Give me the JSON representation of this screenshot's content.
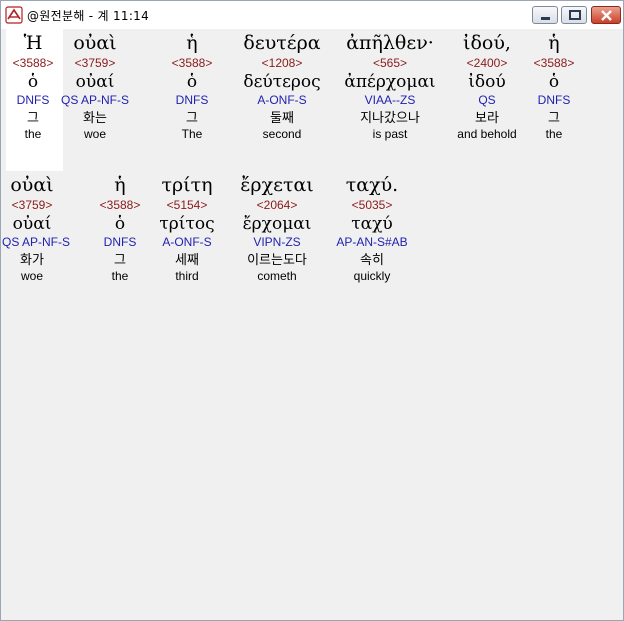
{
  "window": {
    "title": "@원전분해 - 계 11:14"
  },
  "rows": [
    [
      {
        "greek": "Ἡ",
        "strong": "<3588>",
        "lemma": "ὁ",
        "morph": "DNFS",
        "korean": "그",
        "english": "the"
      },
      {
        "greek": "οὐαὶ",
        "strong": "<3759>",
        "lemma": "οὐαί",
        "morph": "QS AP-NF-S",
        "korean": "화는",
        "english": "woe"
      },
      {
        "greek": "ἡ",
        "strong": "<3588>",
        "lemma": "ὁ",
        "morph": "DNFS",
        "korean": "그",
        "english": "The"
      },
      {
        "greek": "δευτέρα",
        "strong": "<1208>",
        "lemma": "δεύτερος",
        "morph": "A-ONF-S",
        "korean": "둘째",
        "english": "second"
      },
      {
        "greek": "ἀπῆλθεν·",
        "strong": "<565>",
        "lemma": "ἀπέρχομαι",
        "morph": "VIAA--ZS",
        "korean": "지나갔으나",
        "english": "is past"
      },
      {
        "greek": "ἰδού,",
        "strong": "<2400>",
        "lemma": "ἰδού",
        "morph": "QS",
        "korean": "보라",
        "english": "and behold"
      },
      {
        "greek": "ἡ",
        "strong": "<3588>",
        "lemma": "ὁ",
        "morph": "DNFS",
        "korean": "그",
        "english": "the"
      }
    ],
    [
      {
        "greek": "οὐαὶ",
        "strong": "<3759>",
        "lemma": "οὐαί",
        "morph": "QS AP-NF-S",
        "korean": "화가",
        "english": "woe"
      },
      {
        "greek": "ἡ",
        "strong": "<3588>",
        "lemma": "ὁ",
        "morph": "DNFS",
        "korean": "그",
        "english": "the"
      },
      {
        "greek": "τρίτη",
        "strong": "<5154>",
        "lemma": "τρίτος",
        "morph": "A-ONF-S",
        "korean": "세째",
        "english": "third"
      },
      {
        "greek": "ἔρχεται",
        "strong": "<2064>",
        "lemma": "ἔρχομαι",
        "morph": "VIPN-ZS",
        "korean": "이르는도다",
        "english": "cometh"
      },
      {
        "greek": "ταχύ.",
        "strong": "<5035>",
        "lemma": "ταχύ",
        "morph": "AP-AN-S#AB",
        "korean": "속히",
        "english": "quickly"
      }
    ]
  ]
}
